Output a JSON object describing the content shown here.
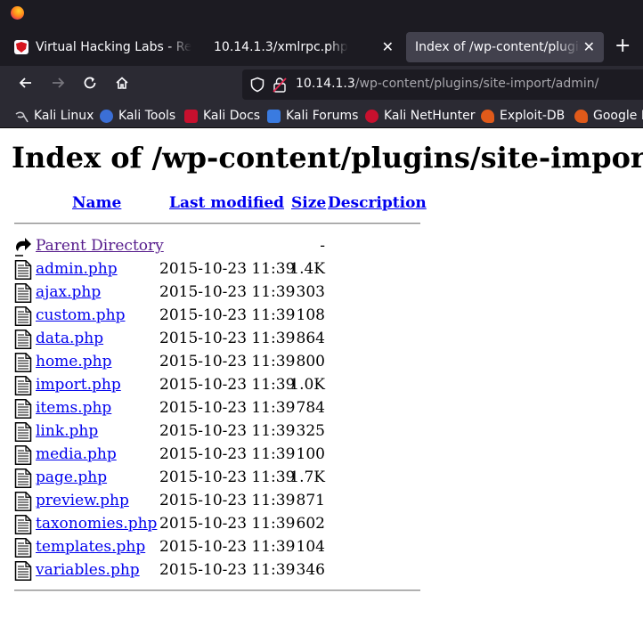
{
  "browser": {
    "tabs": [
      {
        "title": "Virtual Hacking Labs - Re",
        "favicon_color": "#d6141d",
        "active": false
      },
      {
        "title": "10.14.1.3/xmlrpc.php",
        "active": false
      },
      {
        "title": "Index of /wp-content/plugins",
        "active": true
      }
    ],
    "new_tab_glyph": "+",
    "close_glyph": "✕",
    "url": {
      "host": "10.14.1.3",
      "path": "/wp-content/plugins/site-import/admin/"
    },
    "bookmarks": [
      {
        "label": "Kali Linux",
        "icon": "kali-dragon-icon"
      },
      {
        "label": "Kali Tools",
        "icon": "kali-tools-icon"
      },
      {
        "label": "Kali Docs",
        "icon": "kali-docs-icon"
      },
      {
        "label": "Kali Forums",
        "icon": "kali-forums-icon"
      },
      {
        "label": "Kali NetHunter",
        "icon": "kali-nethunter-icon"
      },
      {
        "label": "Exploit-DB",
        "icon": "exploit-db-icon"
      },
      {
        "label": "Google H",
        "icon": "google-hacking-icon"
      }
    ]
  },
  "page": {
    "title": "Index of /wp-content/plugins/site-import/admin",
    "columns": {
      "name": "Name",
      "last_modified": "Last modified",
      "size": "Size",
      "description": "Description"
    },
    "parent": {
      "name": "Parent Directory",
      "size": "-"
    },
    "files": [
      {
        "name": "admin.php",
        "modified": "2015-10-23 11:39",
        "size": "1.4K"
      },
      {
        "name": "ajax.php",
        "modified": "2015-10-23 11:39",
        "size": "303"
      },
      {
        "name": "custom.php",
        "modified": "2015-10-23 11:39",
        "size": "108"
      },
      {
        "name": "data.php",
        "modified": "2015-10-23 11:39",
        "size": "864"
      },
      {
        "name": "home.php",
        "modified": "2015-10-23 11:39",
        "size": "800"
      },
      {
        "name": "import.php",
        "modified": "2015-10-23 11:39",
        "size": "1.0K"
      },
      {
        "name": "items.php",
        "modified": "2015-10-23 11:39",
        "size": "784"
      },
      {
        "name": "link.php",
        "modified": "2015-10-23 11:39",
        "size": "325"
      },
      {
        "name": "media.php",
        "modified": "2015-10-23 11:39",
        "size": "100"
      },
      {
        "name": "page.php",
        "modified": "2015-10-23 11:39",
        "size": "1.7K"
      },
      {
        "name": "preview.php",
        "modified": "2015-10-23 11:39",
        "size": "871"
      },
      {
        "name": "taxonomies.php",
        "modified": "2015-10-23 11:39",
        "size": "602"
      },
      {
        "name": "templates.php",
        "modified": "2015-10-23 11:39",
        "size": "104"
      },
      {
        "name": "variables.php",
        "modified": "2015-10-23 11:39",
        "size": "346"
      }
    ]
  }
}
